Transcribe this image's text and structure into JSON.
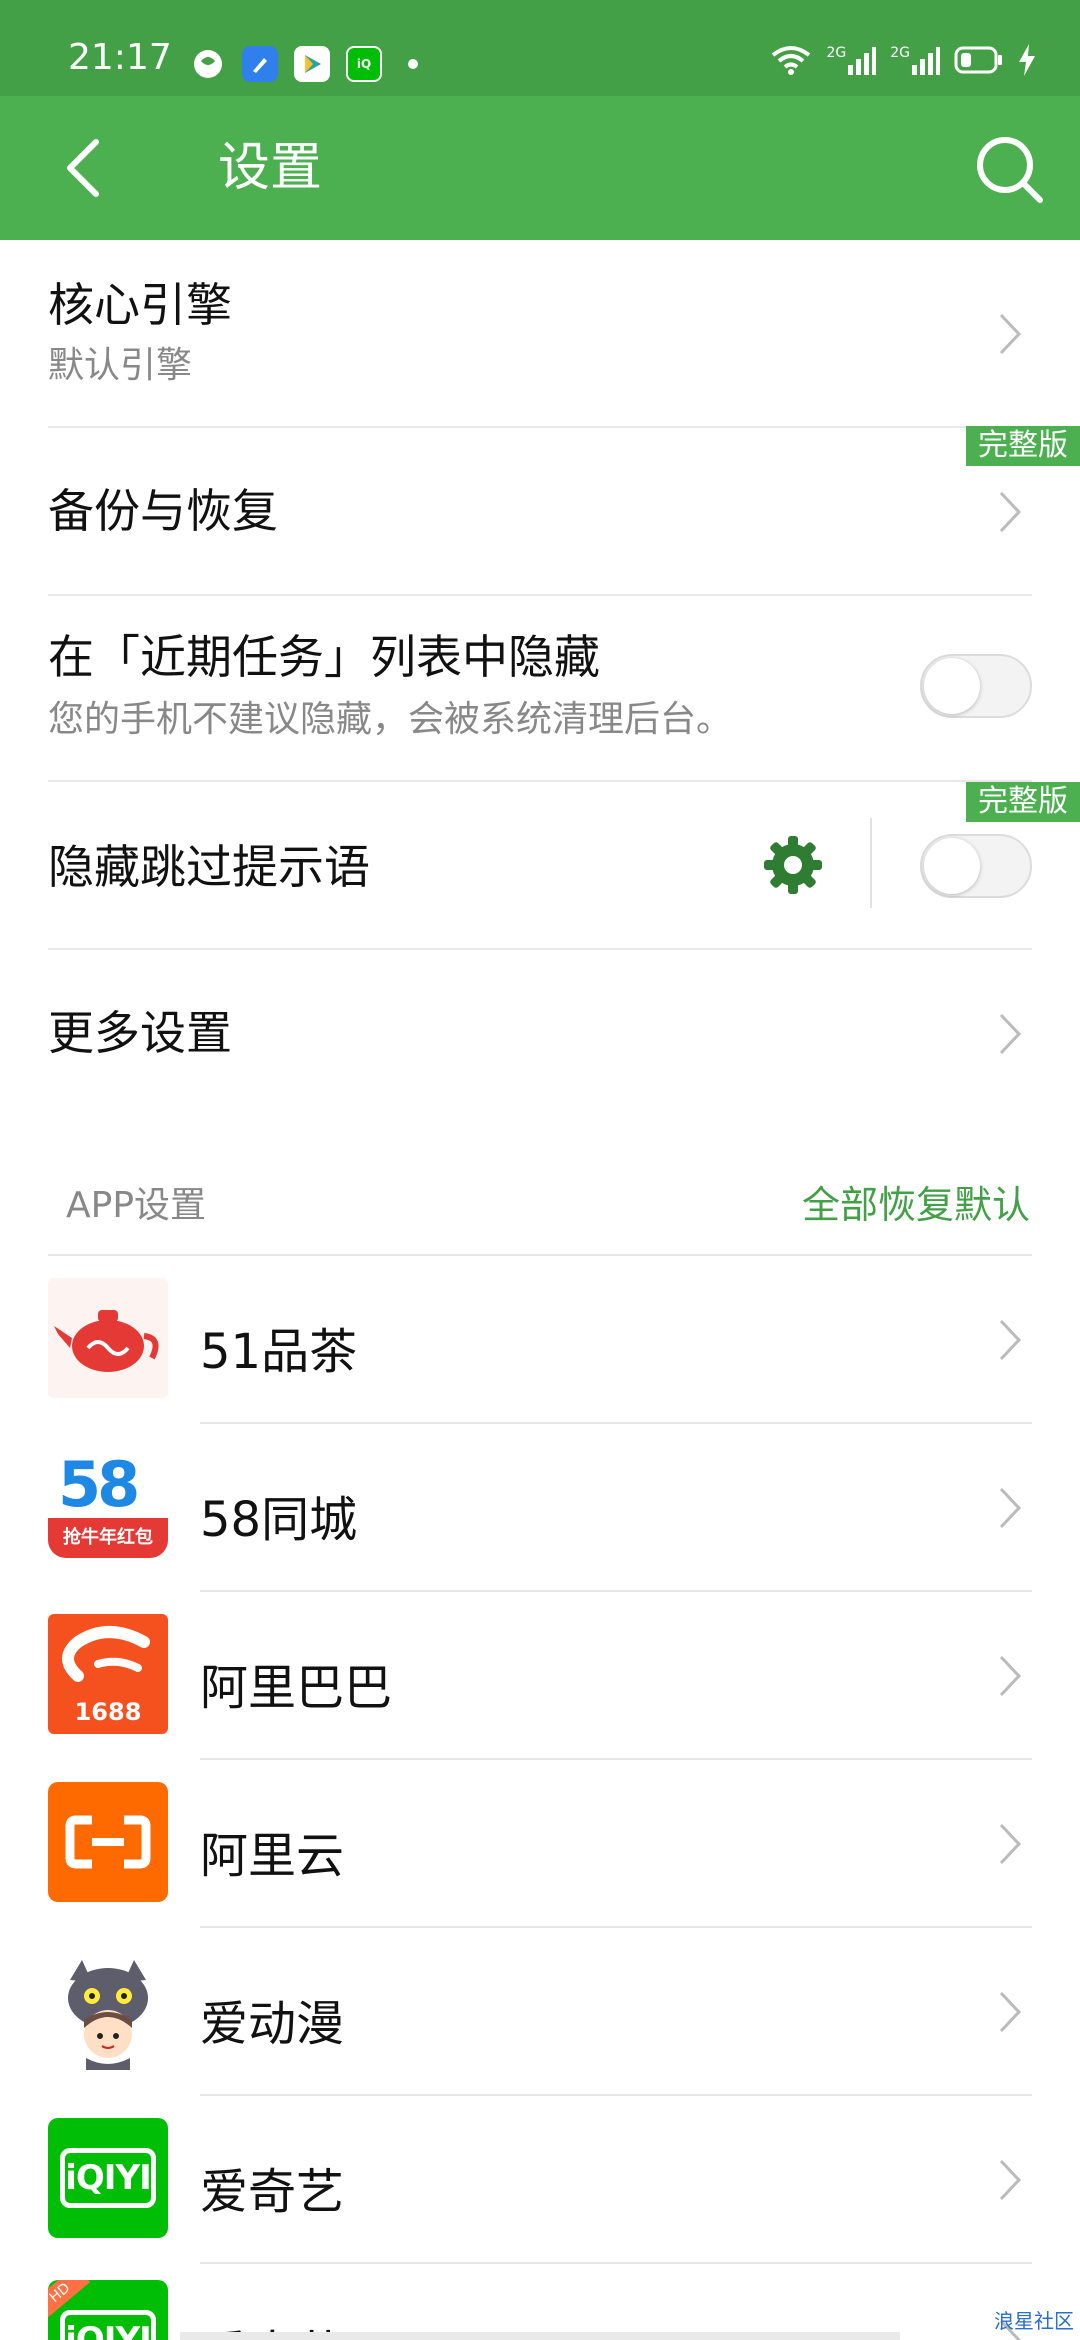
{
  "status_bar": {
    "time": "21:17",
    "network_label_1": "2G",
    "network_label_2": "2G",
    "app_icons": [
      "vpn-icon",
      "cleaner-icon",
      "video-player-icon",
      "iqiyi-icon"
    ]
  },
  "app_bar": {
    "title": "设置",
    "back_icon": "back-arrow-icon",
    "search_icon": "search-icon"
  },
  "settings": [
    {
      "title": "核心引擎",
      "subtitle": "默认引擎",
      "control": "chevron"
    },
    {
      "title": "备份与恢复",
      "badge": "完整版",
      "control": "chevron"
    },
    {
      "title": "在「近期任务」列表中隐藏",
      "subtitle": "您的手机不建议隐藏，会被系统清理后台。",
      "control": "toggle",
      "on": false
    },
    {
      "title": "隐藏跳过提示语",
      "badge": "完整版",
      "control": "gear+toggle",
      "on": false
    },
    {
      "title": "更多设置",
      "control": "chevron"
    }
  ],
  "app_section": {
    "label": "APP设置",
    "action": "全部恢复默认"
  },
  "apps": [
    {
      "name": "51品茶",
      "icon": "teapot-icon"
    },
    {
      "name": "58同城",
      "icon": "58-logo-icon",
      "icon_text": "58",
      "icon_subtext": "抢牛年红包"
    },
    {
      "name": "阿里巴巴",
      "icon": "alibaba-icon",
      "icon_text": "1688"
    },
    {
      "name": "阿里云",
      "icon": "aliyun-icon"
    },
    {
      "name": "爱动漫",
      "icon": "anime-character-icon"
    },
    {
      "name": "爱奇艺",
      "icon": "iqiyi-icon",
      "icon_text": "iQIYI"
    },
    {
      "name": "爱奇艺HD",
      "icon": "iqiyi-hd-icon",
      "icon_text": "iQIYI",
      "icon_subtext": "HD"
    }
  ],
  "watermark": "浪星社区",
  "colors": {
    "status_bar": "#43a047",
    "app_bar": "#4caf50",
    "accent": "#43a047",
    "badge": "#4caf50"
  }
}
